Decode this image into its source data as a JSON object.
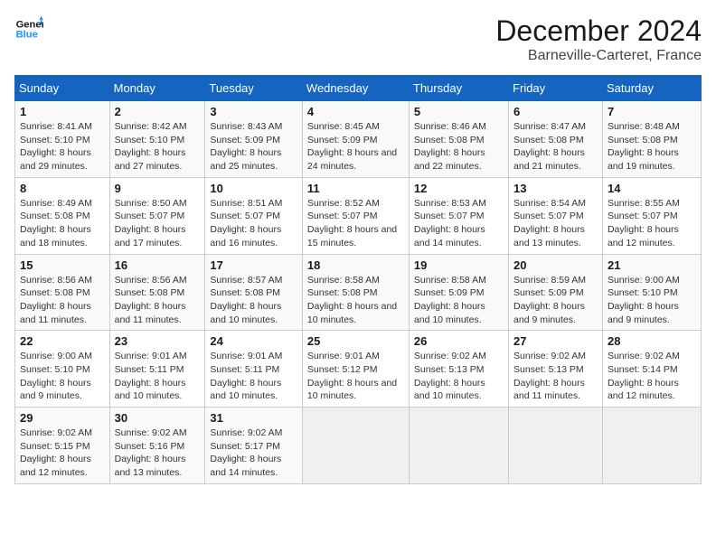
{
  "header": {
    "logo_line1": "General",
    "logo_line2": "Blue",
    "month": "December 2024",
    "location": "Barneville-Carteret, France"
  },
  "days_of_week": [
    "Sunday",
    "Monday",
    "Tuesday",
    "Wednesday",
    "Thursday",
    "Friday",
    "Saturday"
  ],
  "weeks": [
    [
      {
        "day": "1",
        "sunrise": "8:41 AM",
        "sunset": "5:10 PM",
        "daylight": "8 hours and 29 minutes."
      },
      {
        "day": "2",
        "sunrise": "8:42 AM",
        "sunset": "5:10 PM",
        "daylight": "8 hours and 27 minutes."
      },
      {
        "day": "3",
        "sunrise": "8:43 AM",
        "sunset": "5:09 PM",
        "daylight": "8 hours and 25 minutes."
      },
      {
        "day": "4",
        "sunrise": "8:45 AM",
        "sunset": "5:09 PM",
        "daylight": "8 hours and 24 minutes."
      },
      {
        "day": "5",
        "sunrise": "8:46 AM",
        "sunset": "5:08 PM",
        "daylight": "8 hours and 22 minutes."
      },
      {
        "day": "6",
        "sunrise": "8:47 AM",
        "sunset": "5:08 PM",
        "daylight": "8 hours and 21 minutes."
      },
      {
        "day": "7",
        "sunrise": "8:48 AM",
        "sunset": "5:08 PM",
        "daylight": "8 hours and 19 minutes."
      }
    ],
    [
      {
        "day": "8",
        "sunrise": "8:49 AM",
        "sunset": "5:08 PM",
        "daylight": "8 hours and 18 minutes."
      },
      {
        "day": "9",
        "sunrise": "8:50 AM",
        "sunset": "5:07 PM",
        "daylight": "8 hours and 17 minutes."
      },
      {
        "day": "10",
        "sunrise": "8:51 AM",
        "sunset": "5:07 PM",
        "daylight": "8 hours and 16 minutes."
      },
      {
        "day": "11",
        "sunrise": "8:52 AM",
        "sunset": "5:07 PM",
        "daylight": "8 hours and 15 minutes."
      },
      {
        "day": "12",
        "sunrise": "8:53 AM",
        "sunset": "5:07 PM",
        "daylight": "8 hours and 14 minutes."
      },
      {
        "day": "13",
        "sunrise": "8:54 AM",
        "sunset": "5:07 PM",
        "daylight": "8 hours and 13 minutes."
      },
      {
        "day": "14",
        "sunrise": "8:55 AM",
        "sunset": "5:07 PM",
        "daylight": "8 hours and 12 minutes."
      }
    ],
    [
      {
        "day": "15",
        "sunrise": "8:56 AM",
        "sunset": "5:08 PM",
        "daylight": "8 hours and 11 minutes."
      },
      {
        "day": "16",
        "sunrise": "8:56 AM",
        "sunset": "5:08 PM",
        "daylight": "8 hours and 11 minutes."
      },
      {
        "day": "17",
        "sunrise": "8:57 AM",
        "sunset": "5:08 PM",
        "daylight": "8 hours and 10 minutes."
      },
      {
        "day": "18",
        "sunrise": "8:58 AM",
        "sunset": "5:08 PM",
        "daylight": "8 hours and 10 minutes."
      },
      {
        "day": "19",
        "sunrise": "8:58 AM",
        "sunset": "5:09 PM",
        "daylight": "8 hours and 10 minutes."
      },
      {
        "day": "20",
        "sunrise": "8:59 AM",
        "sunset": "5:09 PM",
        "daylight": "8 hours and 9 minutes."
      },
      {
        "day": "21",
        "sunrise": "9:00 AM",
        "sunset": "5:10 PM",
        "daylight": "8 hours and 9 minutes."
      }
    ],
    [
      {
        "day": "22",
        "sunrise": "9:00 AM",
        "sunset": "5:10 PM",
        "daylight": "8 hours and 9 minutes."
      },
      {
        "day": "23",
        "sunrise": "9:01 AM",
        "sunset": "5:11 PM",
        "daylight": "8 hours and 10 minutes."
      },
      {
        "day": "24",
        "sunrise": "9:01 AM",
        "sunset": "5:11 PM",
        "daylight": "8 hours and 10 minutes."
      },
      {
        "day": "25",
        "sunrise": "9:01 AM",
        "sunset": "5:12 PM",
        "daylight": "8 hours and 10 minutes."
      },
      {
        "day": "26",
        "sunrise": "9:02 AM",
        "sunset": "5:13 PM",
        "daylight": "8 hours and 10 minutes."
      },
      {
        "day": "27",
        "sunrise": "9:02 AM",
        "sunset": "5:13 PM",
        "daylight": "8 hours and 11 minutes."
      },
      {
        "day": "28",
        "sunrise": "9:02 AM",
        "sunset": "5:14 PM",
        "daylight": "8 hours and 12 minutes."
      }
    ],
    [
      {
        "day": "29",
        "sunrise": "9:02 AM",
        "sunset": "5:15 PM",
        "daylight": "8 hours and 12 minutes."
      },
      {
        "day": "30",
        "sunrise": "9:02 AM",
        "sunset": "5:16 PM",
        "daylight": "8 hours and 13 minutes."
      },
      {
        "day": "31",
        "sunrise": "9:02 AM",
        "sunset": "5:17 PM",
        "daylight": "8 hours and 14 minutes."
      },
      null,
      null,
      null,
      null
    ]
  ],
  "labels": {
    "sunrise": "Sunrise:",
    "sunset": "Sunset:",
    "daylight": "Daylight:"
  }
}
